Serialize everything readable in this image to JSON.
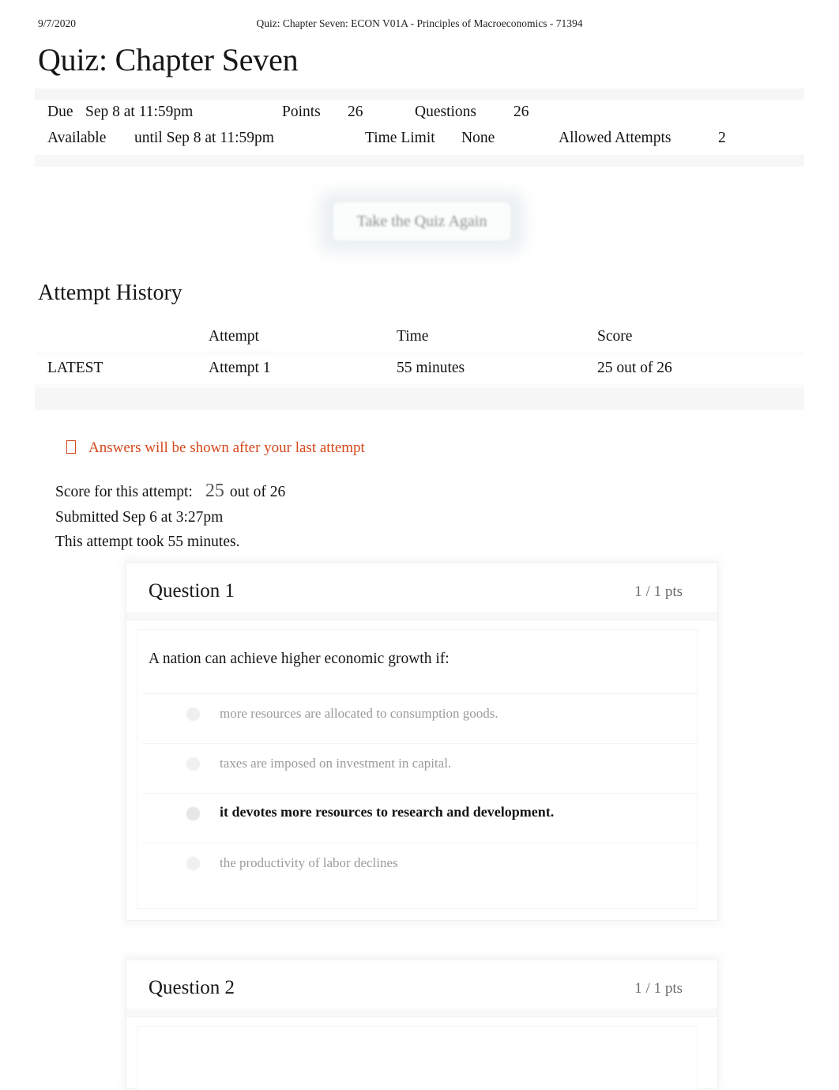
{
  "print_header": {
    "date": "9/7/2020",
    "document_title": "Quiz: Chapter Seven: ECON V01A - Principles of Macroeconomics - 71394"
  },
  "page_title": "Quiz: Chapter Seven",
  "quiz_meta": {
    "due_label": "Due",
    "due_value": "Sep 8 at 11:59pm",
    "points_label": "Points",
    "points_value": "26",
    "questions_label": "Questions",
    "questions_value": "26",
    "available_label": "Available",
    "available_value": "until Sep 8 at 11:59pm",
    "time_limit_label": "Time Limit",
    "time_limit_value": "None",
    "allowed_attempts_label": "Allowed Attempts",
    "allowed_attempts_value": "2"
  },
  "take_quiz_again_label": "Take the Quiz Again",
  "attempt_history": {
    "section_title": "Attempt History",
    "columns": [
      "",
      "Attempt",
      "Time",
      "Score"
    ],
    "rows": [
      {
        "marker": "LATEST",
        "attempt": "Attempt 1",
        "time": "55 minutes",
        "score": "25 out of 26"
      }
    ]
  },
  "answers_notice": "Answers will be shown after your last attempt",
  "score_summary": {
    "score_label": "Score for this attempt:",
    "score_value": "25",
    "score_out_of": "out of 26",
    "submitted": "Submitted Sep 6 at 3:27pm",
    "duration": "This attempt took 55 minutes."
  },
  "questions": [
    {
      "title": "Question 1",
      "points": "1 / 1 pts",
      "prompt": "A nation can achieve higher economic growth if:",
      "answers": [
        {
          "text": "more resources are allocated to consumption goods.",
          "selected": false
        },
        {
          "text": "taxes are imposed on investment in capital.",
          "selected": false
        },
        {
          "text": "it devotes more resources to research and development.",
          "selected": true
        },
        {
          "text": "the productivity of labor declines",
          "selected": false
        }
      ]
    },
    {
      "title": "Question 2",
      "points": "1 / 1 pts",
      "prompt": "",
      "answers": []
    }
  ],
  "colors": {
    "link_blue": "#1f9bd6",
    "notice_orange": "#d6481c",
    "muted_gray": "#9b9b9b",
    "points_gray": "#6d6d6d"
  }
}
